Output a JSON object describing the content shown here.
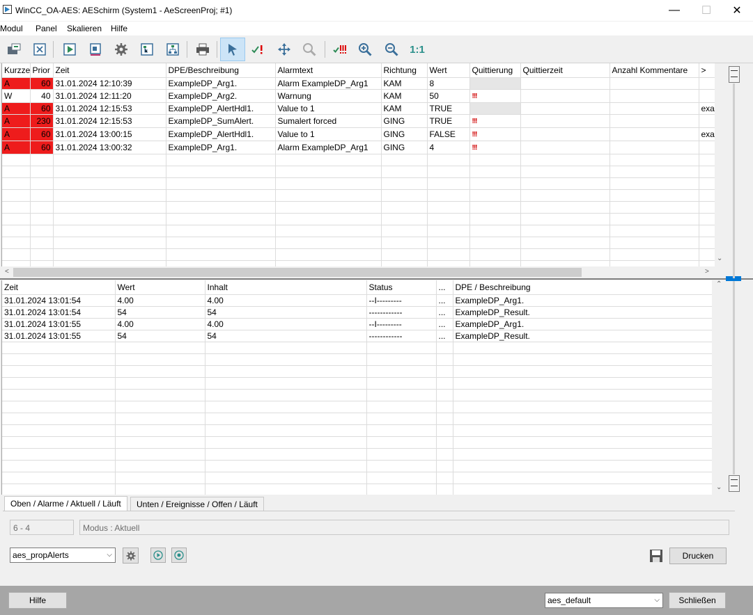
{
  "window": {
    "title": "WinCC_OA-AES: AESchirm (System1 - AeScreenProj; #1)",
    "minimize": "—",
    "maximize": "☐",
    "close": "✕"
  },
  "menu": [
    "Modul",
    "Panel",
    "Skalieren",
    "Hilfe"
  ],
  "toolbar": {
    "zoom_reset_label": "1:1"
  },
  "alarm_table": {
    "columns": [
      "Kurzzeichen",
      "Prior",
      "Zeit",
      "DPE/Beschreibung",
      "Alarmtext",
      "Richtung",
      "Wert",
      "Quittierung",
      "Quittierzeit",
      "Anzahl Kommentare",
      ">"
    ],
    "rows": [
      {
        "kurz": "A",
        "prio": "60",
        "zeit": "31.01.2024 12:10:39",
        "dpe": "ExampleDP_Arg1.",
        "text": " Alarm  ExampleDP_Arg1",
        "richtung": "KAM",
        "wert": "8",
        "quitt": "",
        "extra": "",
        "red": true,
        "ack_gray": true
      },
      {
        "kurz": "W",
        "prio": "40",
        "zeit": "31.01.2024 12:11:20",
        "dpe": "ExampleDP_Arg2.",
        "text": "Warnung",
        "richtung": "KAM",
        "wert": "50",
        "quitt": "!!!",
        "extra": "",
        "red": false,
        "ack_gray": false
      },
      {
        "kurz": "A",
        "prio": "60",
        "zeit": "31.01.2024 12:15:53",
        "dpe": "ExampleDP_AlertHdl1.",
        "text": "Value to 1",
        "richtung": "KAM",
        "wert": "TRUE",
        "quitt": "",
        "extra": "exa",
        "red": true,
        "ack_gray": true
      },
      {
        "kurz": "A",
        "prio": "230",
        "zeit": "31.01.2024 12:15:53",
        "dpe": "ExampleDP_SumAlert.",
        "text": "Sumalert forced",
        "richtung": "GING",
        "wert": "TRUE",
        "quitt": "!!!",
        "extra": "",
        "red": true,
        "ack_gray": false
      },
      {
        "kurz": "A",
        "prio": "60",
        "zeit": "31.01.2024 13:00:15",
        "dpe": "ExampleDP_AlertHdl1.",
        "text": "Value to 1",
        "richtung": "GING",
        "wert": "FALSE",
        "quitt": "!!!",
        "extra": "exa",
        "red": true,
        "ack_gray": false
      },
      {
        "kurz": "A",
        "prio": "60",
        "zeit": "31.01.2024 13:00:32",
        "dpe": "ExampleDP_Arg1.",
        "text": " Alarm  ExampleDP_Arg1",
        "richtung": "GING",
        "wert": "4",
        "quitt": "!!!",
        "extra": "",
        "red": true,
        "ack_gray": false
      }
    ]
  },
  "event_table": {
    "columns": [
      "Zeit",
      "Wert",
      "Inhalt",
      "Status",
      "...",
      "DPE / Beschreibung"
    ],
    "rows": [
      {
        "zeit": "31.01.2024 13:01:54",
        "wert": "4.00",
        "inhalt": "4.00",
        "status": "--I---------",
        "dots": "...",
        "dpe": "ExampleDP_Arg1."
      },
      {
        "zeit": "31.01.2024 13:01:54",
        "wert": "54",
        "inhalt": "54",
        "status": "------------",
        "dots": "...",
        "dpe": "ExampleDP_Result."
      },
      {
        "zeit": "31.01.2024 13:01:55",
        "wert": "4.00",
        "inhalt": "4.00",
        "status": "--I---------",
        "dots": "...",
        "dpe": "ExampleDP_Arg1."
      },
      {
        "zeit": "31.01.2024 13:01:55",
        "wert": "54",
        "inhalt": "54",
        "status": "------------",
        "dots": "...",
        "dpe": "ExampleDP_Result."
      }
    ]
  },
  "tabs": [
    "Oben / Alarme / Aktuell / Läuft",
    "Unten / Ereignisse / Offen / Läuft"
  ],
  "controls": {
    "count_field": "6 - 4",
    "mode_field": "Modus : Aktuell",
    "config_select": "aes_propAlerts",
    "print_button": "Drucken",
    "help_button": "Hilfe",
    "profile_select": "aes_default",
    "close_button": "Schließen"
  },
  "colors": {
    "alarm_red": "#ee1c1c",
    "ack_text": "#d00000",
    "accent_blue": "#0078d7"
  }
}
